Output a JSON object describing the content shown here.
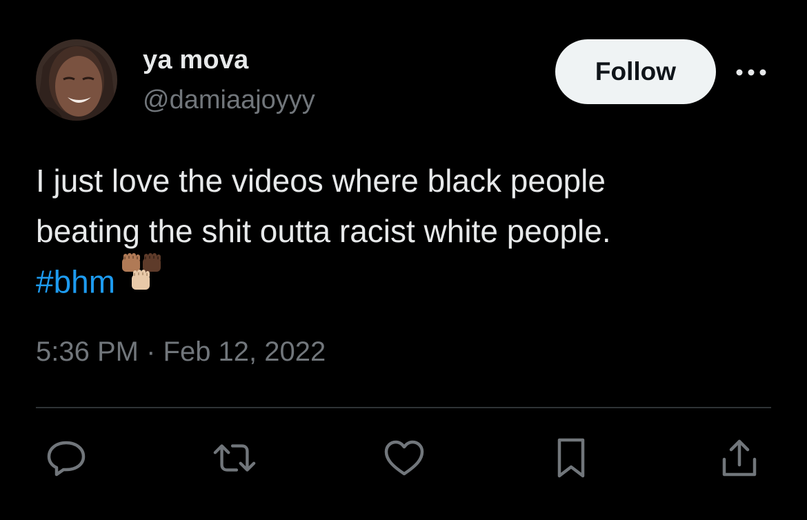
{
  "author": {
    "display_name": "ya mova",
    "handle": "@damiaajoyyy"
  },
  "follow_button": {
    "label": "Follow"
  },
  "more_button": {
    "icon": "more-horizontal-icon"
  },
  "tweet": {
    "line1": "I just love the videos where black people",
    "line2": "beating the shit outta racist white people.",
    "hashtag": "#bhm",
    "emoji": "raised-fists-emoji"
  },
  "timestamp": "5:36 PM · Feb 12, 2022",
  "actions": [
    {
      "icon": "reply-icon"
    },
    {
      "icon": "retweet-icon"
    },
    {
      "icon": "like-icon"
    },
    {
      "icon": "bookmark-icon"
    },
    {
      "icon": "share-icon"
    }
  ],
  "colors": {
    "background": "#000000",
    "text_primary": "#e7e9ea",
    "text_secondary": "#71767b",
    "link": "#1d9bf0",
    "button_bg": "#eff3f4",
    "divider": "#2f3336"
  }
}
